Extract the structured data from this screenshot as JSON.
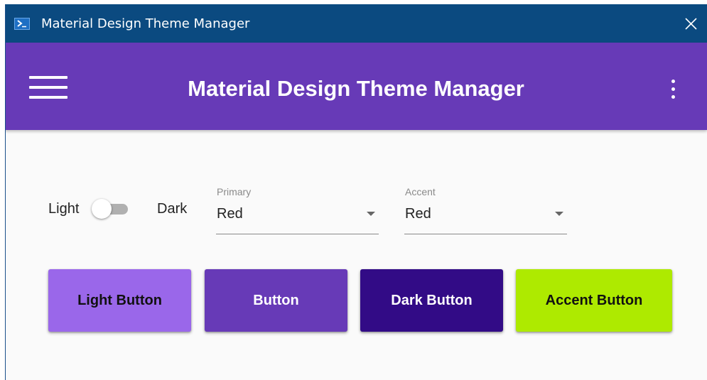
{
  "window": {
    "title": "Material Design Theme Manager"
  },
  "appbar": {
    "title": "Material Design Theme Manager"
  },
  "theme_toggle": {
    "left_label": "Light",
    "right_label": "Dark",
    "checked": false
  },
  "primary_select": {
    "caption": "Primary",
    "value": "Red"
  },
  "accent_select": {
    "caption": "Accent",
    "value": "Red"
  },
  "buttons": {
    "light": {
      "label": "Light Button",
      "background": "#9a67ea",
      "color": "#111111"
    },
    "mid": {
      "label": "Button",
      "background": "#673ab7",
      "color": "#ffffff"
    },
    "dark": {
      "label": "Dark Button",
      "background": "#320b86",
      "color": "#ffffff"
    },
    "accent": {
      "label": "Accent Button",
      "background": "#aeea00",
      "color": "#111111"
    }
  },
  "colors": {
    "titlebar": "#0b4a80",
    "appbar": "#673ab7",
    "content": "#fafafa"
  },
  "icons": {
    "app": "powershell-icon",
    "close": "close-icon",
    "menu": "hamburger-menu-icon",
    "more": "more-vertical-icon",
    "dropdown": "dropdown-arrow-icon"
  }
}
